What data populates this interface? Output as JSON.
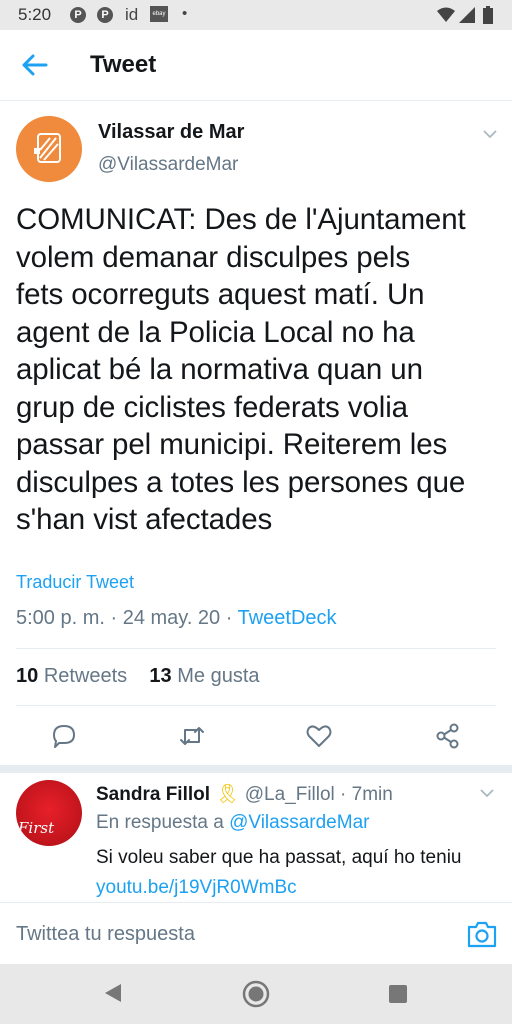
{
  "status_bar": {
    "time": "5:20",
    "id_label": "id",
    "ebay_label": "ebay",
    "icons": [
      "pinterest-icon",
      "pinterest-icon",
      "id-icon",
      "ebay-icon",
      "dot-icon",
      "wifi-icon",
      "signal-icon",
      "battery-icon"
    ]
  },
  "header": {
    "title": "Tweet",
    "back_icon": "back-arrow-icon"
  },
  "tweet": {
    "author_name": "Vilassar de Mar",
    "author_handle": "@VilassardeMar",
    "lines": [
      "COMUNICAT: Des de l'Ajuntament",
      "volem demanar disculpes pels",
      "fets ocorreguts aquest matí. Un",
      "agent de la Policia Local no ha",
      "aplicat bé la normativa quan un",
      "grup de ciclistes federats volia",
      "passar pel municipi. Reiterem les",
      "disculpes a totes les persones que",
      "s'han vist afectades"
    ],
    "translate_label": "Traducir Tweet",
    "time": "5:00 p. m.",
    "separator": " · ",
    "date": "24 may. 20",
    "source": "TweetDeck"
  },
  "stats": {
    "retweets_count": "10",
    "retweets_label": "Retweets",
    "likes_count": "13",
    "likes_label": "Me gusta"
  },
  "actions": [
    "reply-icon",
    "retweet-icon",
    "like-icon",
    "share-icon"
  ],
  "reply": {
    "name": "Sandra Fillol",
    "emoji": "🎗",
    "handle": "@La_Fillol",
    "time": "7min",
    "separator": " · ",
    "context_prefix": "En respuesta a",
    "context_handle": "@VilassardeMar",
    "text": "Si voleu saber que ha passat, aquí ho teniu",
    "link": "youtu.be/j19VjR0WmBc",
    "avatar_text": "First"
  },
  "compose": {
    "placeholder": "Twittea tu respuesta"
  },
  "colors": {
    "accent": "#1da1f2",
    "secondary_text": "#657786",
    "avatar_orange": "#f08a3c"
  }
}
